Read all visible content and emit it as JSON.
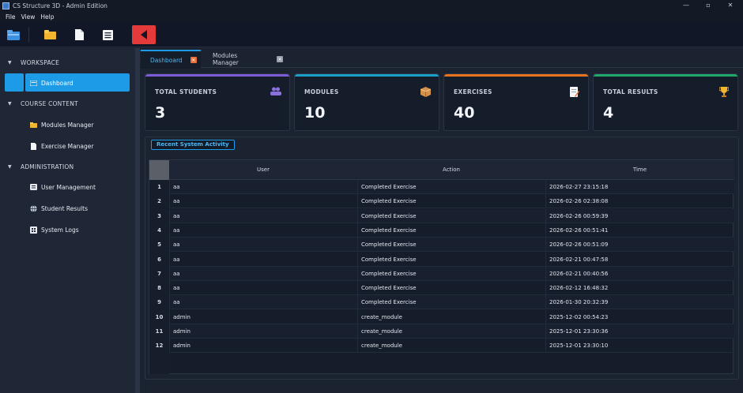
{
  "window": {
    "title": "CS Structure 3D - Admin Edition",
    "minimize": "—",
    "maximize": "▫",
    "close": "✕"
  },
  "menu": [
    "File",
    "View",
    "Help"
  ],
  "toolbar": [
    "home-icon",
    "folder-icon",
    "file-icon",
    "list-icon",
    "back-icon"
  ],
  "sidebar": {
    "sections": [
      {
        "label": "WORKSPACE",
        "items": [
          {
            "label": "Dashboard",
            "icon": "dashboard-icon",
            "active": true
          }
        ]
      },
      {
        "label": "COURSE CONTENT",
        "items": [
          {
            "label": "Modules Manager",
            "icon": "folder-icon"
          },
          {
            "label": "Exercise Manager",
            "icon": "file-icon"
          }
        ]
      },
      {
        "label": "ADMINISTRATION",
        "items": [
          {
            "label": "User Management",
            "icon": "user-card-icon"
          },
          {
            "label": "Student Results",
            "icon": "globe-icon"
          },
          {
            "label": "System Logs",
            "icon": "grid-icon"
          }
        ]
      }
    ]
  },
  "tabs": [
    {
      "label": "Dashboard",
      "active": true
    },
    {
      "label": "Modules Manager",
      "active": false
    }
  ],
  "stats": [
    {
      "label": "TOTAL STUDENTS",
      "value": "3",
      "color": "#7b5cd6",
      "icon": "👥"
    },
    {
      "label": "MODULES",
      "value": "10",
      "color": "#1aa0c8",
      "icon": "📦"
    },
    {
      "label": "EXERCISES",
      "value": "40",
      "color": "#e8731c",
      "icon": "📝"
    },
    {
      "label": "TOTAL RESULTS",
      "value": "4",
      "color": "#1fa86a",
      "icon": "🏆"
    }
  ],
  "activity": {
    "title": "Recent System Activity",
    "columns": [
      "User",
      "Action",
      "Time"
    ],
    "rows": [
      [
        "1",
        "aa",
        "Completed Exercise",
        "2026-02-27 23:15:18"
      ],
      [
        "2",
        "aa",
        "Completed Exercise",
        "2026-02-26 02:38:08"
      ],
      [
        "3",
        "aa",
        "Completed Exercise",
        "2026-02-26 00:59:39"
      ],
      [
        "4",
        "aa",
        "Completed Exercise",
        "2026-02-26 00:51:41"
      ],
      [
        "5",
        "aa",
        "Completed Exercise",
        "2026-02-26 00:51:09"
      ],
      [
        "6",
        "aa",
        "Completed Exercise",
        "2026-02-21 00:47:58"
      ],
      [
        "7",
        "aa",
        "Completed Exercise",
        "2026-02-21 00:40:56"
      ],
      [
        "8",
        "aa",
        "Completed Exercise",
        "2026-02-12 16:48:32"
      ],
      [
        "9",
        "aa",
        "Completed Exercise",
        "2026-01-30 20:32:39"
      ],
      [
        "10",
        "admin",
        "create_module",
        "2025-12-02 00:54:23"
      ],
      [
        "11",
        "admin",
        "create_module",
        "2025-12-01 23:30:36"
      ],
      [
        "12",
        "admin",
        "create_module",
        "2025-12-01 23:30:10"
      ]
    ]
  }
}
